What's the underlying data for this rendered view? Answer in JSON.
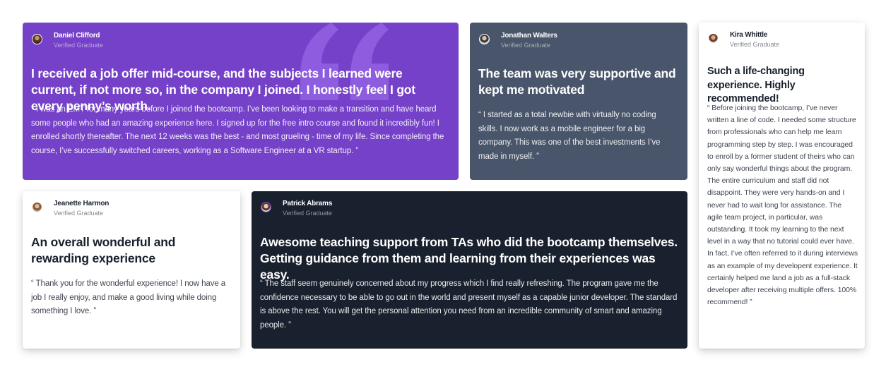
{
  "testimonials": [
    {
      "name": "Daniel Clifford",
      "role": "Verified Graduate",
      "headline": "I received a job offer mid-course, and the subjects I learned were current, if not more so, in the company I joined. I honestly feel I got every penny’s worth.",
      "quote": "“ I was an EMT for many years before I joined the bootcamp. I’ve been looking to make a transition and have heard some people who had an amazing experience here. I signed up for the free intro course and found it incredibly fun! I enrolled shortly thereafter. The next 12 weeks was the best - and most grueling - time of my life. Since completing the course, I’ve successfully switched careers, working as a Software Engineer at a VR startup. ”",
      "background": "#7541c8"
    },
    {
      "name": "Jonathan Walters",
      "role": "Verified Graduate",
      "headline": "The team was very supportive and kept me motivated",
      "quote": "“ I started as a total newbie with virtually no coding skills. I now work as a mobile engineer for a big company. This was one of the best investments I’ve made in myself. ”",
      "background": "#48556a"
    },
    {
      "name": "Kira Whittle",
      "role": "Verified Graduate",
      "headline": "Such a life-changing experience. Highly recommended!",
      "quote": "“ Before joining the bootcamp, I’ve never written a line of code. I needed some structure from professionals who can help me learn programming step by step. I was encouraged to enroll by a former student of theirs who can only say wonderful things about the program. The entire curriculum and staff did not disappoint. They were very hands-on and I never had to wait long for assistance. The agile team project, in particular, was outstanding. It took my learning to the next level in a way that no tutorial could ever have. In fact, I’ve often referred to it during interviews as an example of my developent experience. It certainly helped me land a job as a full-stack developer after receiving multiple offers. 100% recommend! ”",
      "background": "#ffffff"
    },
    {
      "name": "Jeanette Harmon",
      "role": "Verified Graduate",
      "headline": "An overall wonderful and rewarding experience",
      "quote": "“ Thank you for the wonderful experience! I now have a job I really enjoy, and make a good living while doing something I love. ”",
      "background": "#ffffff"
    },
    {
      "name": "Patrick Abrams",
      "role": "Verified Graduate",
      "headline": "Awesome teaching support from TAs who did the bootcamp themselves. Getting guidance from them and learning from their experiences was easy.",
      "quote": "“ The staff seem genuinely concerned about my progress which I find really refreshing. The program gave me the confidence necessary to be able to go out in the world and present myself as a capable junior developer. The standard is above the rest. You will get the personal attention you need from an incredible community of smart and amazing people. ”",
      "background": "#19212e"
    }
  ],
  "icons": {
    "decorative_quote": "quote-icon",
    "avatar": "avatar"
  },
  "colors": {
    "violet": "#7541c8",
    "grayish_blue": "#48556a",
    "dark_blue": "#19212e",
    "white": "#ffffff"
  }
}
